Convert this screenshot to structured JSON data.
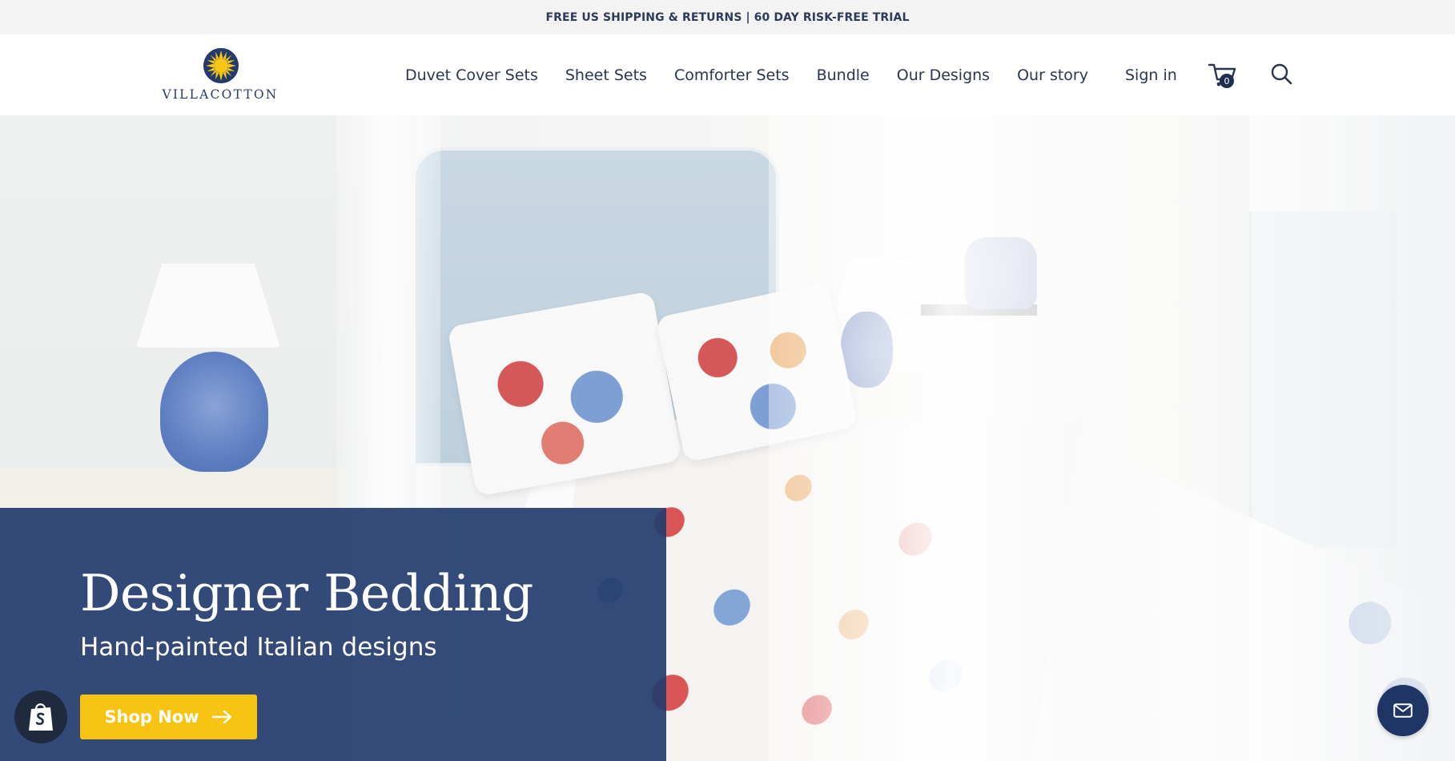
{
  "announcement": {
    "text": "FREE US SHIPPING & RETURNS | 60 DAY RISK-FREE TRIAL"
  },
  "header": {
    "logo_text": "VILLACOTTON",
    "nav": [
      {
        "label": "Duvet Cover Sets"
      },
      {
        "label": "Sheet Sets"
      },
      {
        "label": "Comforter Sets"
      },
      {
        "label": "Bundle"
      },
      {
        "label": "Our Designs"
      },
      {
        "label": "Our story"
      }
    ],
    "signin_label": "Sign in",
    "cart_count": "0",
    "icons": {
      "cart": "cart-icon",
      "search": "search-icon"
    }
  },
  "hero": {
    "title": "Designer Bedding",
    "subtitle": "Hand-painted Italian designs",
    "cta_label": "Shop Now",
    "panel_color": "#233c6e",
    "cta_color": "#f7c414"
  },
  "floating": {
    "shopify_icon": "shopify-bag-icon",
    "contact_icon": "mail-icon"
  }
}
